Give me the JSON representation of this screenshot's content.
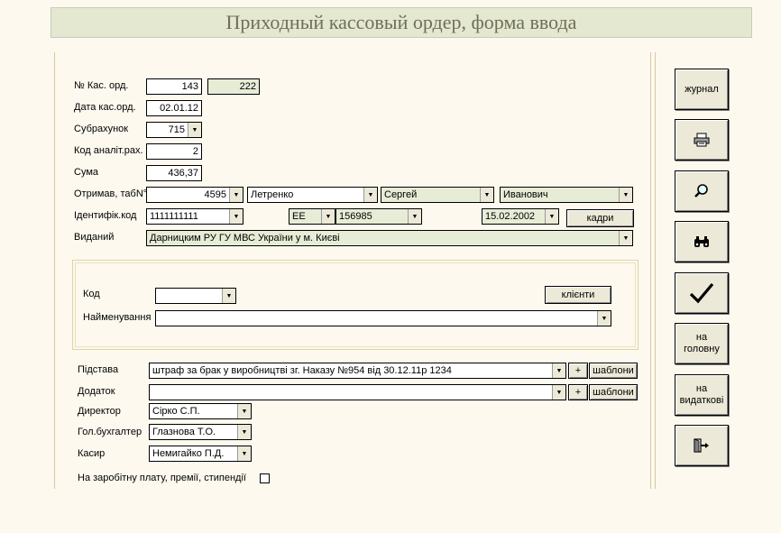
{
  "title": "Приходный кассовый ордер, форма ввода",
  "fields": {
    "order_no_label": "№ Кас. орд.",
    "order_no": "143",
    "order_no2": "222",
    "date_label": "Дата кас.орд.",
    "date": "02.01.12",
    "subaccount_label": "Субрахунок",
    "subaccount": "715",
    "analytic_label": "Код аналіт.рах.",
    "analytic": "2",
    "sum_label": "Сума",
    "sum": "436,37",
    "recipient_label": "Отримав, табN°",
    "recipient_tab": "4595",
    "surname": "Летренко",
    "name": "Сергей",
    "patronymic": "Иванович",
    "ident_label": "Ідентифік.код",
    "ident": "1111111111",
    "passport_series": "EE",
    "passport_no": "156985",
    "passport_date": "15.02.2002",
    "issued_label": "Виданий",
    "issued": "Дарницким РУ ГУ МВС України у м. Києві"
  },
  "buttons": {
    "staff": "кадри",
    "clients": "клієнти",
    "plus": "+",
    "templates": "шаблони"
  },
  "client": {
    "code_label": "Код",
    "code": "",
    "name_label": "Найменування",
    "name": ""
  },
  "bottom": {
    "basis_label": "Підстава",
    "basis": "штраф за брак у виробництві зг. Наказу  №954 від 30.12.11р 1234",
    "addendum_label": "Додаток",
    "addendum": "",
    "director_label": "Директор",
    "director": "Сірко С.П.",
    "chief_accountant_label": "Гол.бухгалтер",
    "chief_accountant": "Глазнова Т.О.",
    "cashier_label": "Касир",
    "cashier": "Немигайко П.Д.",
    "salary_label": "На заробітну плату, премії, стипендії"
  },
  "sidebar": {
    "journal": "журнал",
    "to_main": "на головну",
    "to_expense": "на видаткові"
  },
  "icons": {
    "print": "printer-icon",
    "search": "magnifier-icon",
    "find": "binoculars-icon",
    "ok": "checkmark-icon",
    "exit": "exit-door-icon"
  }
}
